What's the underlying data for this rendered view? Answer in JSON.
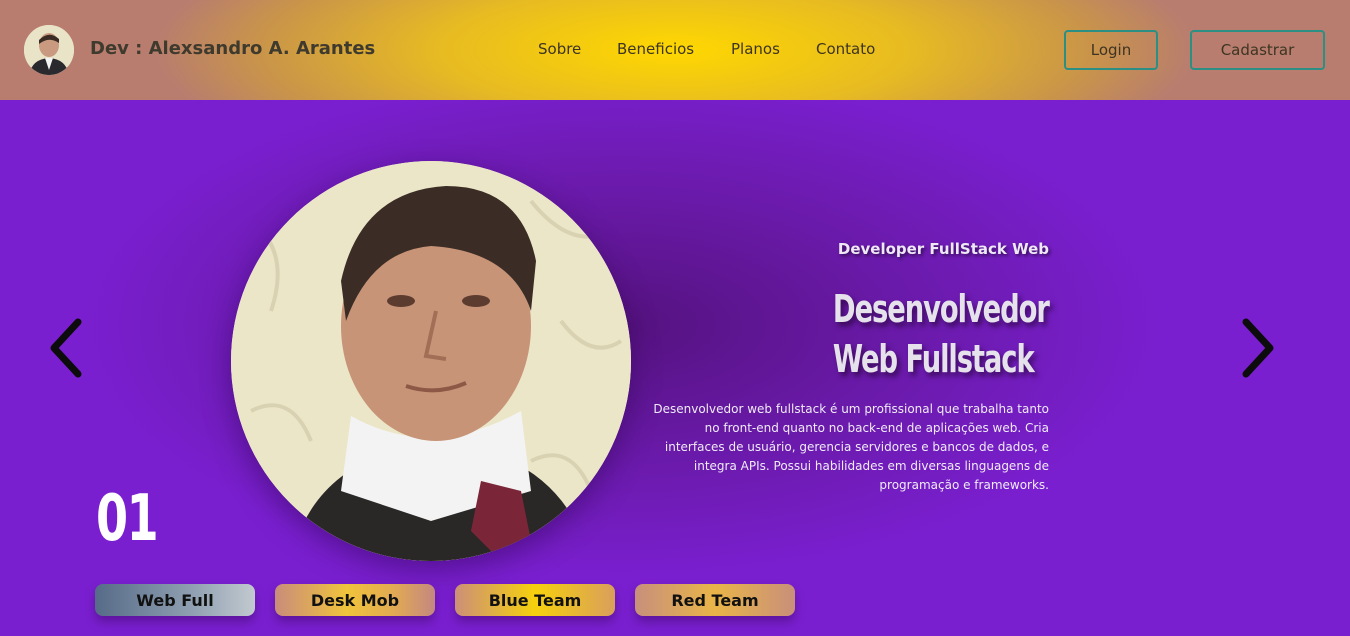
{
  "header": {
    "brand": "Dev : Alexsandro A. Arantes",
    "avatar_icon": "person-avatar-icon",
    "nav": [
      {
        "label": "Sobre"
      },
      {
        "label": "Beneficios"
      },
      {
        "label": "Planos"
      },
      {
        "label": "Contato"
      }
    ],
    "login_label": "Login",
    "signup_label": "Cadastrar"
  },
  "hero": {
    "subtitle": "Developer FullStack Web",
    "title_line1": "Desenvolvedor",
    "title_line2": "Web Fullstack",
    "description": "Desenvolvedor web fullstack é um profissional que trabalha tanto no front-end quanto no back-end de aplicações web. Cria interfaces de usuário, gerencia servidores e bancos de dados, e integra APIs. Possui habilidades em diversas linguagens de programação e frameworks.",
    "counter": "01",
    "prev_icon": "chevron-left-icon",
    "next_icon": "chevron-right-icon",
    "tabs": [
      {
        "label": "Web Full"
      },
      {
        "label": "Desk Mob"
      },
      {
        "label": "Blue Team"
      },
      {
        "label": "Red Team"
      }
    ]
  },
  "colors": {
    "header_gold": "#ffd800",
    "hero_purple": "#7a1fd0",
    "button_border": "#2b8f84"
  }
}
